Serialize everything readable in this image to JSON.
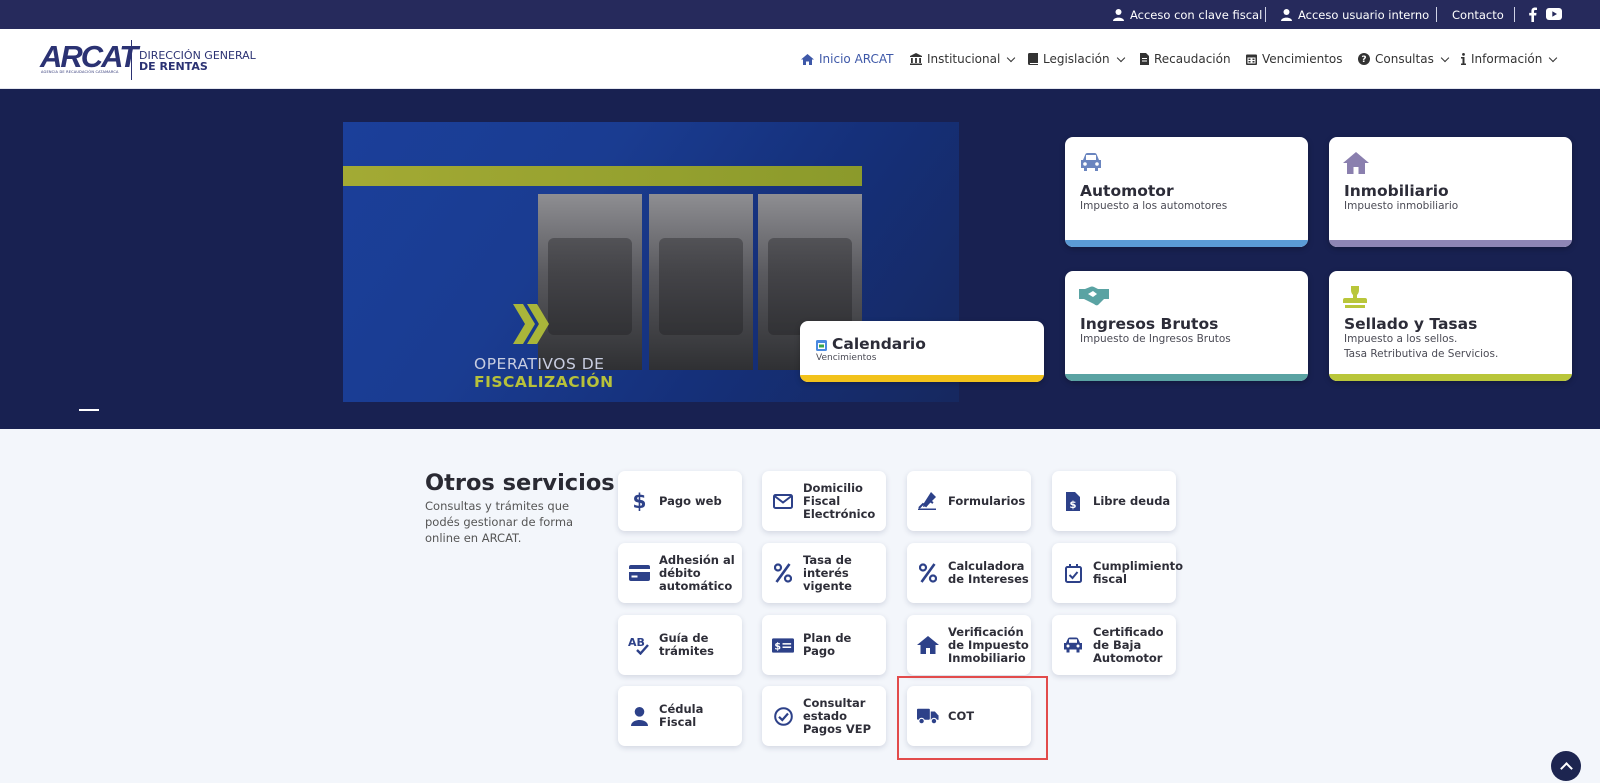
{
  "topbar": {
    "acceso_clave": "Acceso con clave fiscal",
    "acceso_interno": "Acceso usuario interno",
    "contacto": "Contacto"
  },
  "logo": {
    "brand": "ARCAT",
    "brand_sub": "AGENCIA DE RECAUDACIÓN CATAMARCA",
    "line1": "DIRECCIÓN GENERAL",
    "line2": "DE RENTAS"
  },
  "nav": {
    "inicio": "Inicio ARCAT",
    "institucional": "Institucional",
    "legislacion": "Legislación",
    "recaudacion": "Recaudación",
    "vencimientos": "Vencimientos",
    "consultas": "Consultas",
    "informacion": "Información"
  },
  "hero": {
    "slide_line1": "OPERATIVOS DE",
    "slide_line2": "FISCALIZACIÓN"
  },
  "cards": {
    "automotor": {
      "title": "Automotor",
      "sub": "Impuesto a los automotores"
    },
    "inmobiliario": {
      "title": "Inmobiliario",
      "sub": "Impuesto inmobiliario"
    },
    "ingresos": {
      "title": "Ingresos Brutos",
      "sub": "Impuesto de Ingresos Brutos"
    },
    "sellado": {
      "title": "Sellado y Tasas",
      "sub": "Impuesto a los sellos.",
      "sub2": "Tasa Retributiva de Servicios."
    },
    "calendario": {
      "title": "Calendario",
      "sub": "Vencimientos"
    }
  },
  "otros": {
    "title": "Otros servicios",
    "desc": "Consultas y trámites que podés gestionar de forma online en ARCAT."
  },
  "services": {
    "pago_web": "Pago web",
    "domicilio": "Domicilio Fiscal Electrónico",
    "formularios": "Formularios",
    "libre_deuda": "Libre deuda",
    "adhesion": "Adhesión al débito automático",
    "tasa": "Tasa de interés vigente",
    "calculadora": "Calculadora de Intereses",
    "cumplimiento": "Cumplimiento fiscal",
    "guia": "Guía de trámites",
    "plan": "Plan de Pago",
    "verificacion": "Verificación de Impuesto Inmobiliario",
    "certificado": "Certificado de Baja Automotor",
    "cedula": "Cédula Fiscal",
    "consultar": "Consultar estado Pagos VEP",
    "cot": "COT"
  },
  "colors": {
    "navy": "#262a5c",
    "hero_bg": "#182151",
    "automotor_bar": "#5b9bd5",
    "inmobiliario_bar": "#8e86b5",
    "ingresos_bar": "#5aa3a3",
    "sellado_bar": "#b9c63a",
    "calendario_bar": "#f2c21b",
    "highlight": "#e24b4b"
  }
}
